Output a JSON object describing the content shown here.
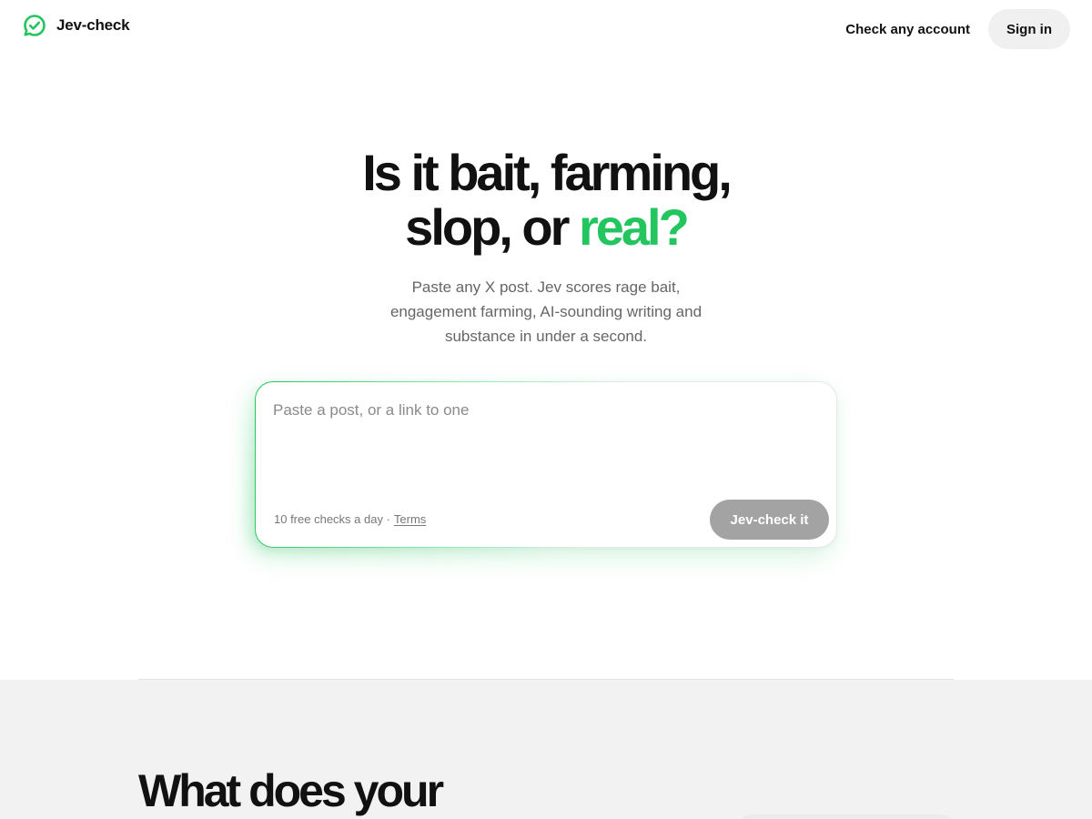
{
  "header": {
    "brand_name": "Jev-check",
    "brand_icon": "check-badge-icon",
    "nav_link": "Check any account",
    "sign_in_label": "Sign in"
  },
  "hero": {
    "title_line1": "Is it bait, farming,",
    "title_line2_prefix": "slop, or ",
    "title_line2_accent": "real?",
    "subtitle": "Paste any X post. Jev scores rage bait, engagement farming, AI-sounding writing and substance in under a second."
  },
  "input_card": {
    "placeholder": "Paste a post, or a link to one",
    "value": "",
    "footer_text": "10 free checks a day ·",
    "terms_label": "Terms",
    "submit_label": "Jev-check it"
  },
  "lower_section": {
    "title": "What does your"
  },
  "colors": {
    "accent": "#22c55e",
    "text": "#111111",
    "muted": "#666666",
    "button_disabled": "#a3a3a3",
    "section_bg": "#f2f2f2"
  }
}
